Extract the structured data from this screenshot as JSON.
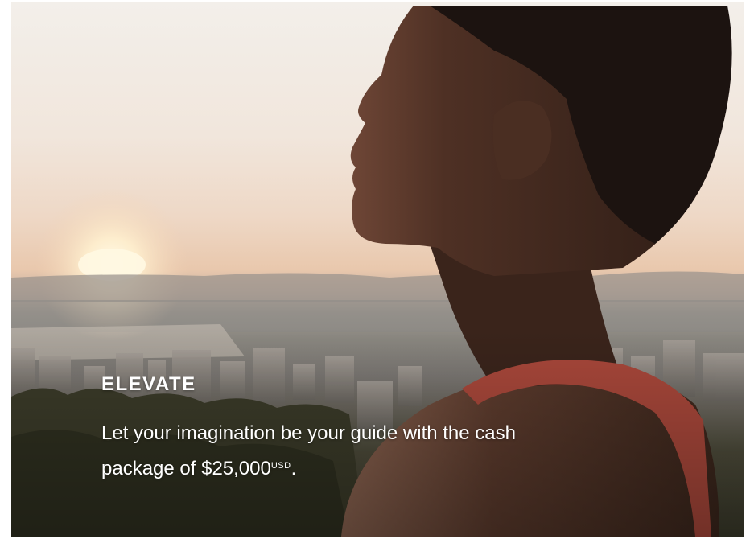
{
  "promo": {
    "heading": "ELEVATE",
    "body_prefix": "Let your imagination be your guide with the cash package of ",
    "amount": "$25,000",
    "currency": "USD",
    "body_suffix": "."
  },
  "colors": {
    "sky_top": "#f3efea",
    "sky_glow": "#eed8c6",
    "sun": "#fff6dc",
    "skin_dark": "#3a251c",
    "top_strap": "#b0483a",
    "foliage": "#3a3a2a",
    "text": "#ffffff"
  }
}
